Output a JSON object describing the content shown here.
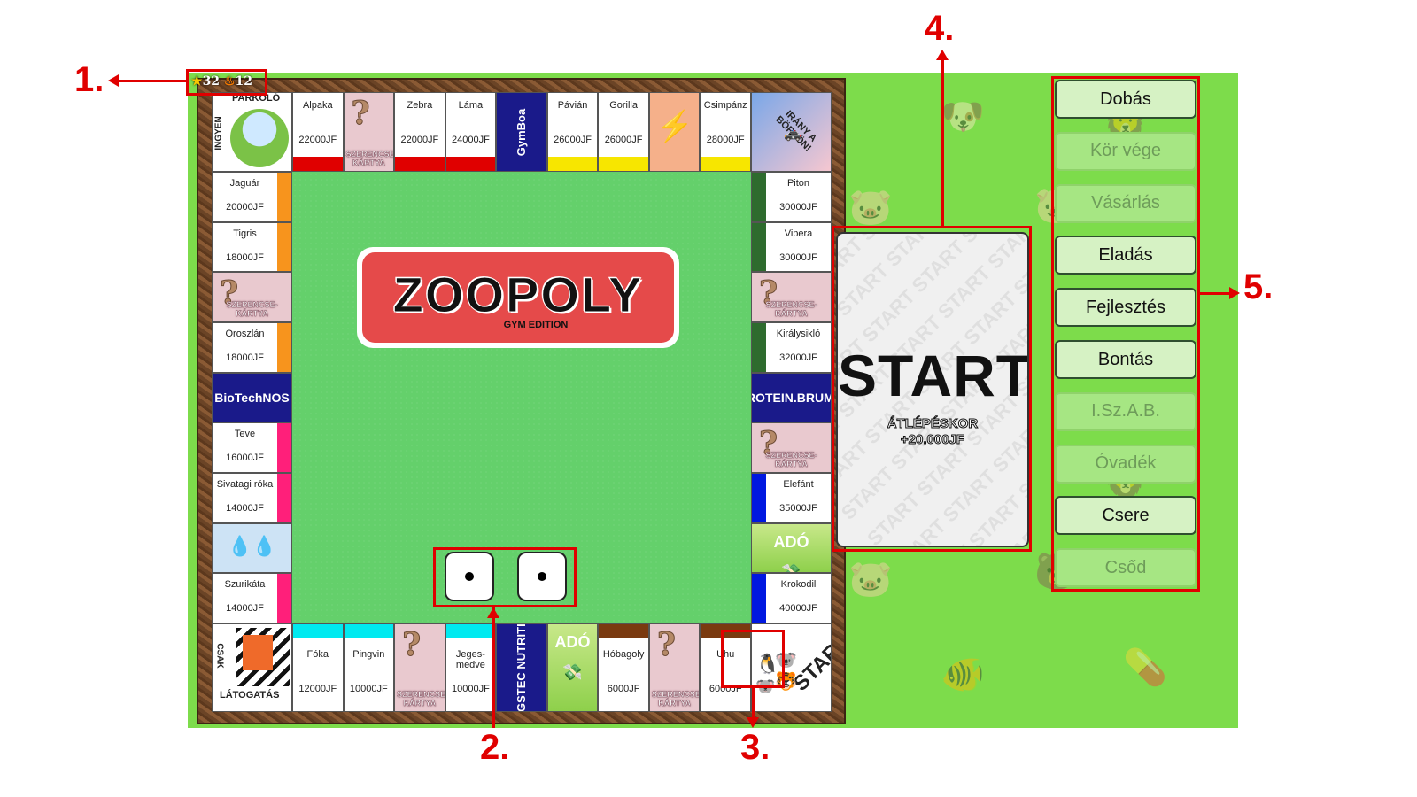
{
  "stats": {
    "stars": "32",
    "flames": "12",
    "star_icon": "star-icon",
    "flame_icon": "flame-icon"
  },
  "board": {
    "logo_title": "ZOOPOLY",
    "logo_sub": "GYM EDITION",
    "corners": {
      "parking": {
        "top": "PARKOLÓ",
        "side": "INGYEN"
      },
      "goto_jail": "IRÁNY A BÖRTÖN!",
      "jail": {
        "side": "CSAK",
        "bottom": "LÁTOGATÁS"
      },
      "start": "START"
    },
    "chance_label": "SZERENCSE-KÁRTYA",
    "top": [
      {
        "name": "Alpaka",
        "price": "22000JF",
        "color": "#e00000"
      },
      {
        "name": "Zebra",
        "price": "22000JF",
        "color": "#e00000"
      },
      {
        "name": "Láma",
        "price": "24000JF",
        "color": "#e00000"
      },
      {
        "sponsor": "GymBoa"
      },
      {
        "name": "Pávián",
        "price": "26000JF",
        "color": "#f7e600"
      },
      {
        "name": "Gorilla",
        "price": "26000JF",
        "color": "#f7e600"
      },
      {
        "name": "Csimpánz",
        "price": "28000JF",
        "color": "#f7e600"
      }
    ],
    "left": [
      {
        "name": "Jaguár",
        "price": "20000JF",
        "color": "#f7941d"
      },
      {
        "name": "Tigris",
        "price": "18000JF",
        "color": "#f7941d"
      },
      {
        "name": "Oroszlán",
        "price": "18000JF",
        "color": "#f7941d"
      },
      {
        "sponsor": "BioTechNOS"
      },
      {
        "name": "Teve",
        "price": "16000JF",
        "color": "#ff1f7a"
      },
      {
        "name": "Sivatagi róka",
        "price": "14000JF",
        "color": "#ff1f7a"
      },
      {
        "name": "Szurikáta",
        "price": "14000JF",
        "color": "#ff1f7a"
      }
    ],
    "right": [
      {
        "name": "Piton",
        "price": "30000JF",
        "color": "#2e6b2e"
      },
      {
        "name": "Vipera",
        "price": "30000JF",
        "color": "#2e6b2e"
      },
      {
        "name": "Királysikló",
        "price": "32000JF",
        "color": "#2e6b2e"
      },
      {
        "sponsor": "PROTEIN.BRUMM"
      },
      {
        "name": "Elefánt",
        "price": "35000JF",
        "color": "#0018e0"
      },
      {
        "tax": "ADÓ"
      },
      {
        "name": "Krokodil",
        "price": "40000JF",
        "color": "#0018e0"
      }
    ],
    "bottom": [
      {
        "name": "Fóka",
        "price": "12000JF",
        "color": "#00eaf0"
      },
      {
        "name": "Pingvin",
        "price": "10000JF",
        "color": "#00eaf0"
      },
      {
        "name": "Jeges-medve",
        "price": "10000JF",
        "color": "#00eaf0"
      },
      {
        "sponsor": "MAGSTEC NUTRITION"
      },
      {
        "tax": "ADÓ"
      },
      {
        "name": "Hóbagoly",
        "price": "6000JF",
        "color": "#7a3a10"
      },
      {
        "name": "Uhu",
        "price": "6000JF",
        "color": "#7a3a10"
      }
    ]
  },
  "dice": [
    1,
    1
  ],
  "info_card": {
    "title": "START",
    "line1": "ÁTLÉPÉSKOR",
    "line2": "+20.000JF",
    "watermark": "START"
  },
  "actions": [
    {
      "label": "Dobás",
      "enabled": true
    },
    {
      "label": "Kör vége",
      "enabled": false
    },
    {
      "label": "Vásárlás",
      "enabled": false
    },
    {
      "label": "Eladás",
      "enabled": true
    },
    {
      "label": "Fejlesztés",
      "enabled": true
    },
    {
      "label": "Bontás",
      "enabled": true
    },
    {
      "label": "I.Sz.A.B.",
      "enabled": false
    },
    {
      "label": "Óvadék",
      "enabled": false
    },
    {
      "label": "Csere",
      "enabled": true
    },
    {
      "label": "Csőd",
      "enabled": false
    }
  ],
  "annotations": [
    "1.",
    "2.",
    "3.",
    "4.",
    "5."
  ],
  "colors": {
    "highlight": "#e00000",
    "game_bg": "#7ddc4b",
    "board_center": "#64d06b"
  }
}
